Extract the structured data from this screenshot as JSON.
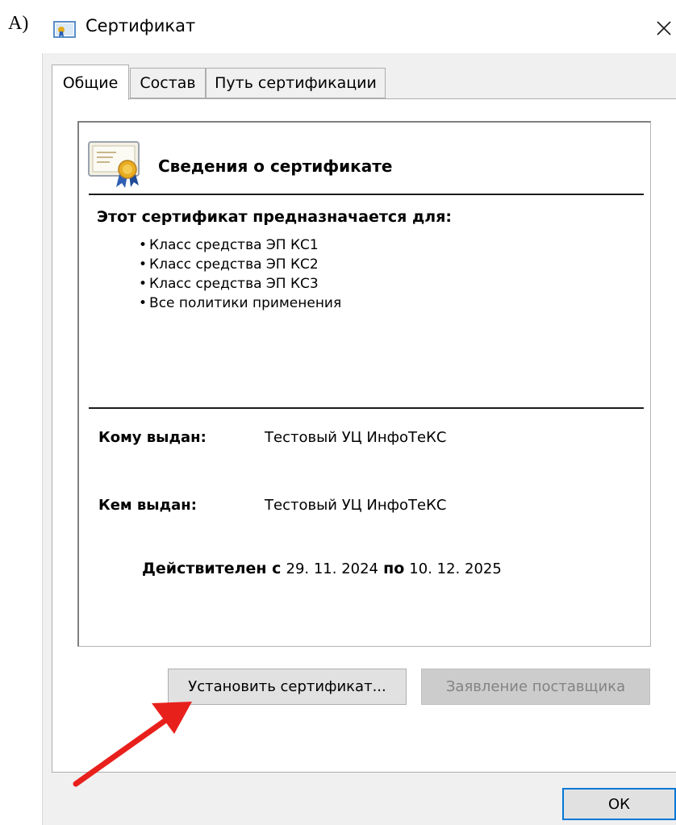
{
  "annotation": {
    "label": "А)"
  },
  "window": {
    "title": "Сертификат",
    "close_glyph": "×",
    "tabs": [
      {
        "label": "Общие",
        "active": true
      },
      {
        "label": "Состав",
        "active": false
      },
      {
        "label": "Путь сертификации",
        "active": false
      }
    ]
  },
  "certificate": {
    "heading": "Сведения о сертификате",
    "purpose_heading": "Этот сертификат предназначается для:",
    "purposes": [
      "Класс средства ЭП КС1",
      "Класс средства ЭП КС2",
      "Класс средства ЭП КС3",
      "Все политики применения"
    ],
    "issued_to_label": "Кому выдан:",
    "issued_to": "Тестовый УЦ ИнфоТеКС",
    "issued_by_label": "Кем выдан:",
    "issued_by": "Тестовый УЦ ИнфоТеКС",
    "valid_from_label": "Действителен с",
    "valid_from": "29. 11. 2024",
    "valid_to_label": "по",
    "valid_to": "10. 12. 2025"
  },
  "buttons": {
    "install": "Установить сертификат...",
    "issuer_statement": "Заявление поставщика",
    "ok": "ОК"
  },
  "colors": {
    "arrow": "#e8201c",
    "focus_border": "#0078d7",
    "window_bg": "#f0f0f0"
  },
  "icons": {
    "title": "certificate-icon",
    "info": "certificate-ribbon-icon",
    "close": "close-icon",
    "annotation": "red-arrow-icon"
  }
}
